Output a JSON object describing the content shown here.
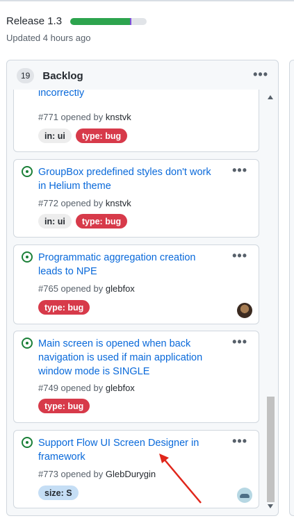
{
  "release": {
    "title": "Release 1.3",
    "updated": "Updated 4 hours ago",
    "progress": {
      "done_percent": 78,
      "in_progress_percent": 2,
      "done_color": "#2da44e",
      "in_progress_color": "#8250df"
    }
  },
  "column": {
    "count": "19",
    "name": "Backlog",
    "menu": "•••"
  },
  "cards": [
    {
      "title": "GroupBox outerMargin attribute works incorrectly",
      "meta_prefix": "#771 opened by ",
      "author": "knstvk",
      "labels": [
        {
          "text": "in: ui",
          "kind": "ui"
        },
        {
          "text": "type: bug",
          "kind": "bug"
        }
      ],
      "menu": "•••"
    },
    {
      "title": "GroupBox predefined styles don't work in Helium theme",
      "meta_prefix": "#772 opened by ",
      "author": "knstvk",
      "labels": [
        {
          "text": "in: ui",
          "kind": "ui"
        },
        {
          "text": "type: bug",
          "kind": "bug"
        }
      ],
      "menu": "•••"
    },
    {
      "title": "Programmatic aggregation creation leads to NPE",
      "meta_prefix": "#765 opened by ",
      "author": "glebfox",
      "labels": [
        {
          "text": "type: bug",
          "kind": "bug"
        }
      ],
      "menu": "•••"
    },
    {
      "title": "Main screen is opened when back navigation is used if main application window mode is SINGLE",
      "meta_prefix": "#749 opened by ",
      "author": "glebfox",
      "labels": [
        {
          "text": "type: bug",
          "kind": "bug"
        }
      ],
      "menu": "•••"
    },
    {
      "title": "Support Flow UI Screen Designer in framework",
      "meta_prefix": "#773 opened by ",
      "author": "GlebDurygin",
      "labels": [
        {
          "text": "size: S",
          "kind": "size"
        }
      ],
      "menu": "•••"
    }
  ],
  "colors": {
    "link": "#0969da",
    "open_issue": "#1a7f37",
    "bug_label": "#d73a4a",
    "size_label": "#c5def5",
    "annotation_arrow": "#e0261b"
  }
}
